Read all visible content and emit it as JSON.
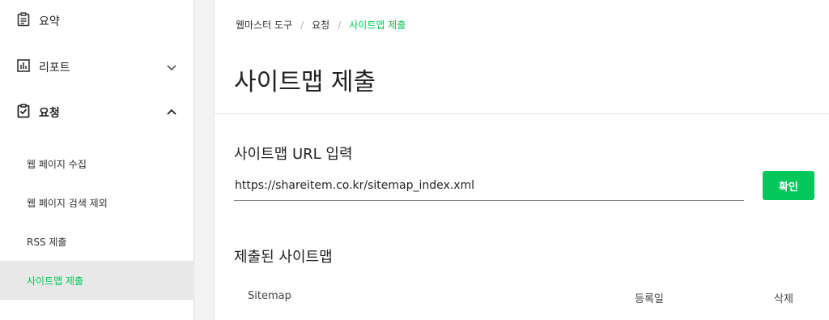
{
  "sidebar": {
    "items": [
      {
        "label": "요약",
        "icon": "document-icon"
      },
      {
        "label": "리포트",
        "icon": "bar-chart-icon",
        "expanded": false
      },
      {
        "label": "요청",
        "icon": "clipboard-check-icon",
        "expanded": true
      }
    ],
    "sub_items": [
      {
        "label": "웹 페이지 수집"
      },
      {
        "label": "웹 페이지 검색 제외"
      },
      {
        "label": "RSS 제출"
      },
      {
        "label": "사이트맵 제출",
        "active": true
      }
    ]
  },
  "breadcrumb": {
    "items": [
      "웹마스터 도구",
      "요청",
      "사이트맵 제출"
    ],
    "separator": "/"
  },
  "page": {
    "title": "사이트맵 제출"
  },
  "url_section": {
    "title": "사이트맵 URL 입력",
    "input_value": "https://shareitem.co.kr/sitemap_index.xml",
    "button_label": "확인"
  },
  "submitted_section": {
    "title": "제출된 사이트맵",
    "columns": [
      "Sitemap",
      "등록일",
      "삭제"
    ]
  },
  "colors": {
    "accent": "#03c75a",
    "active_bg": "#e8e8e8"
  }
}
